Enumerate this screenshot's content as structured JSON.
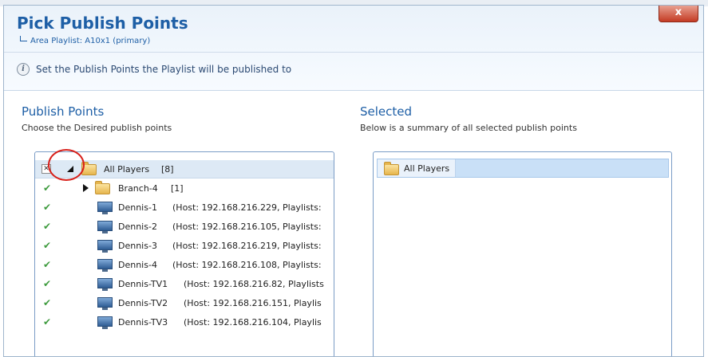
{
  "dialog": {
    "title": "Pick Publish Points",
    "subtitle": "Area Playlist: A10x1 (primary)",
    "info_text": "Set the Publish Points the Playlist will be published to",
    "close_label": "x"
  },
  "publish_points": {
    "title": "Publish Points",
    "description": "Choose the Desired publish points",
    "tree": {
      "root_label": "All Players",
      "root_count": "[8]",
      "group_label": "Branch-4",
      "group_count": "[1]",
      "items": [
        {
          "name": "Dennis-1",
          "details": "(Host: 192.168.216.229, Playlists:"
        },
        {
          "name": "Dennis-2",
          "details": "(Host: 192.168.216.105, Playlists:"
        },
        {
          "name": "Dennis-3",
          "details": "(Host: 192.168.216.219, Playlists:"
        },
        {
          "name": "Dennis-4",
          "details": "(Host: 192.168.216.108, Playlists:"
        },
        {
          "name": "Dennis-TV1",
          "details": "(Host: 192.168.216.82, Playlists"
        },
        {
          "name": "Dennis-TV2",
          "details": "(Host: 192.168.216.151, Playlis"
        },
        {
          "name": "Dennis-TV3",
          "details": "(Host: 192.168.216.104, Playlis"
        }
      ]
    }
  },
  "selected": {
    "title": "Selected",
    "description": "Below is a summary of all selected publish points",
    "items": [
      {
        "label": "All Players"
      }
    ]
  },
  "icons": {
    "check": "checkmark-icon",
    "folder": "folder-icon",
    "player": "monitor-icon",
    "info": "info-icon"
  },
  "colors": {
    "title_blue": "#1e5fa6",
    "check_green": "#3e9b3e",
    "highlight_red": "#d8201a",
    "selection_blue": "#c9e0f7"
  }
}
